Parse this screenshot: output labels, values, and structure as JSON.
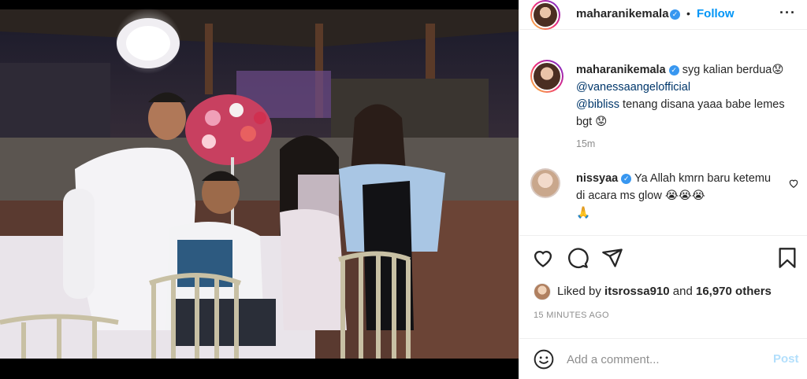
{
  "post": {
    "image_alt": "Group photo of four people at an evening event with chandelier and flowers",
    "colors": {
      "accent": "#0095f6",
      "verified": "#3897f0",
      "muted": "#8e8e8e",
      "text": "#262626"
    }
  },
  "header": {
    "username": "maharanikemala",
    "separator": "•",
    "follow_label": "Follow",
    "more_icon": "more-horizontal-icon"
  },
  "caption": {
    "username": "maharanikemala",
    "text_start": "syg kalian berdua",
    "emoji_1": "😟",
    "mention_1": "@vanessaangelofficial",
    "mention_2": "@bibliss",
    "text_end": " tenang disana yaaa babe lemes bgt",
    "emoji_2": "😟",
    "time": "15m"
  },
  "comments": [
    {
      "username": "nissyaa",
      "text": " Ya Allah kmrn baru ketemu di acara ms glow ",
      "emoji": "😭😭😭",
      "emoji_2": "🙏"
    }
  ],
  "actions": {
    "like_icon": "heart-icon",
    "comment_icon": "comment-icon",
    "share_icon": "share-icon",
    "save_icon": "bookmark-icon"
  },
  "likes": {
    "prefix": "Liked by ",
    "user": "itsrossa910",
    "middle": " and ",
    "count": "16,970 others"
  },
  "timestamp": "15 MINUTES AGO",
  "add_comment": {
    "placeholder": "Add a comment...",
    "post_label": "Post"
  }
}
